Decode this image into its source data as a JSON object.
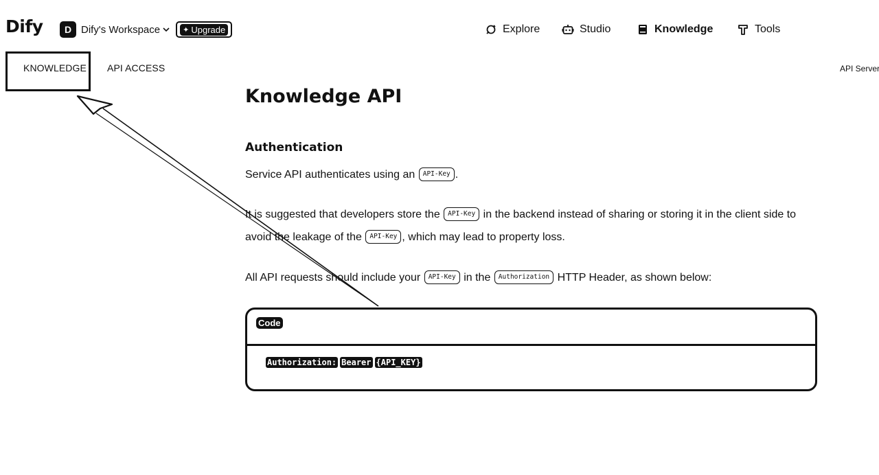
{
  "header": {
    "logo": "Dify",
    "workspace": {
      "avatar_letter": "D",
      "name": "Dify's Workspace",
      "chevron_icon": "chevron-down-icon",
      "upgrade_label": "Upgrade",
      "upgrade_icon": "sparkle-icon"
    },
    "nav": [
      {
        "label": "Explore",
        "icon": "explore-icon",
        "active": false
      },
      {
        "label": "Studio",
        "icon": "robot-icon",
        "active": false
      },
      {
        "label": "Knowledge",
        "icon": "book-icon",
        "active": true
      },
      {
        "label": "Tools",
        "icon": "hammer-icon",
        "active": false
      }
    ]
  },
  "doc_tabs": {
    "knowledge": "KNOWLEDGE",
    "api_access": "API ACCESS",
    "api_server": "API Server"
  },
  "content": {
    "title": "Knowledge API",
    "section_title": "Authentication",
    "p1": {
      "text_a": "Service API authenticates using an ",
      "code": "API-Key",
      "text_b": "."
    },
    "p2": {
      "text_a": "It is suggested that developers store the ",
      "code_1": "API-Key",
      "text_b": " in the backend instead of sharing or storing it in the client side to avoid the leakage of the ",
      "code_2": "API-Key",
      "text_c": ", which may lead to property loss."
    },
    "p3": {
      "text_a": "All API requests should include your ",
      "code_1": "API-Key",
      "text_b": " in the ",
      "code_2": "Authorization",
      "text_c": " HTTP Header, as shown below:"
    },
    "code_block": {
      "title": "Code",
      "tokens": [
        "Authorization:",
        "Bearer",
        "{API_KEY}"
      ]
    }
  },
  "colors": {
    "ink": "#111111",
    "background": "#ffffff"
  }
}
